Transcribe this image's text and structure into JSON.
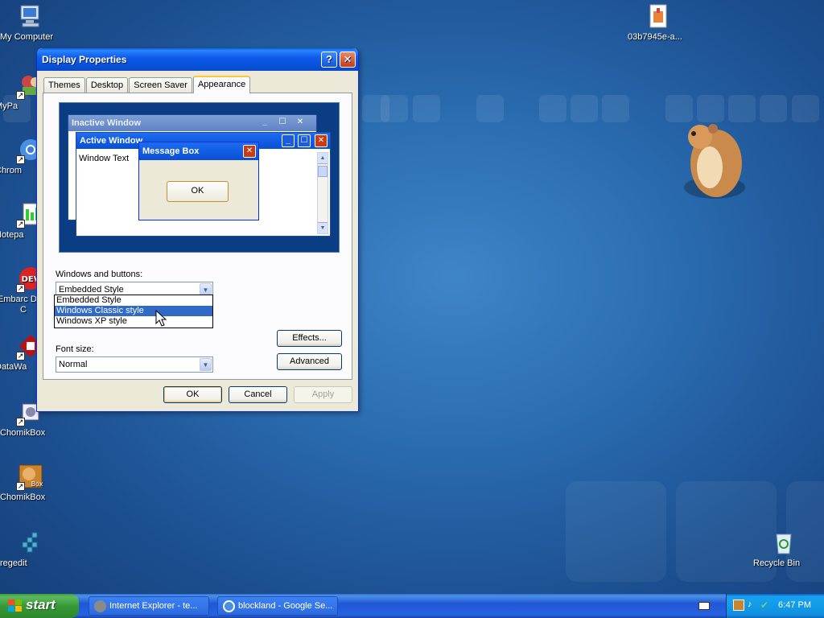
{
  "desktop": {
    "icons": [
      {
        "label": "My Computer"
      },
      {
        "label": "MyPa"
      },
      {
        "label": "Chrom"
      },
      {
        "label": "Notepa"
      },
      {
        "label": "Embarc Dev-C"
      },
      {
        "label": "DataWa"
      },
      {
        "label": "ChomikBox"
      },
      {
        "label": "ChomikBox"
      },
      {
        "label": "regedit"
      },
      {
        "label": "03b7945e-a..."
      },
      {
        "label": "Recycle Bin"
      }
    ]
  },
  "dialog": {
    "title": "Display Properties",
    "help": "?",
    "close": "✕",
    "tabs": [
      {
        "label": "Themes"
      },
      {
        "label": "Desktop"
      },
      {
        "label": "Screen Saver"
      },
      {
        "label": "Appearance"
      }
    ],
    "preview": {
      "inactive_title": "Inactive Window",
      "active_title": "Active Window",
      "window_text": "Window Text",
      "msgbox_title": "Message Box",
      "msgbox_ok": "OK"
    },
    "windows_buttons_label": "Windows and buttons:",
    "windows_buttons_value": "Embedded Style",
    "dropdown_options": [
      {
        "label": "Embedded Style"
      },
      {
        "label": "Windows Classic style"
      },
      {
        "label": "Windows XP style"
      }
    ],
    "font_size_label": "Font size:",
    "font_size_value": "Normal",
    "effects": "Effects...",
    "advanced": "Advanced",
    "ok": "OK",
    "cancel": "Cancel",
    "apply": "Apply"
  },
  "taskbar": {
    "start": "start",
    "tasks": [
      {
        "label": "Internet Explorer - te..."
      },
      {
        "label": "blockland - Google Se..."
      }
    ],
    "clock": "6:47 PM"
  }
}
